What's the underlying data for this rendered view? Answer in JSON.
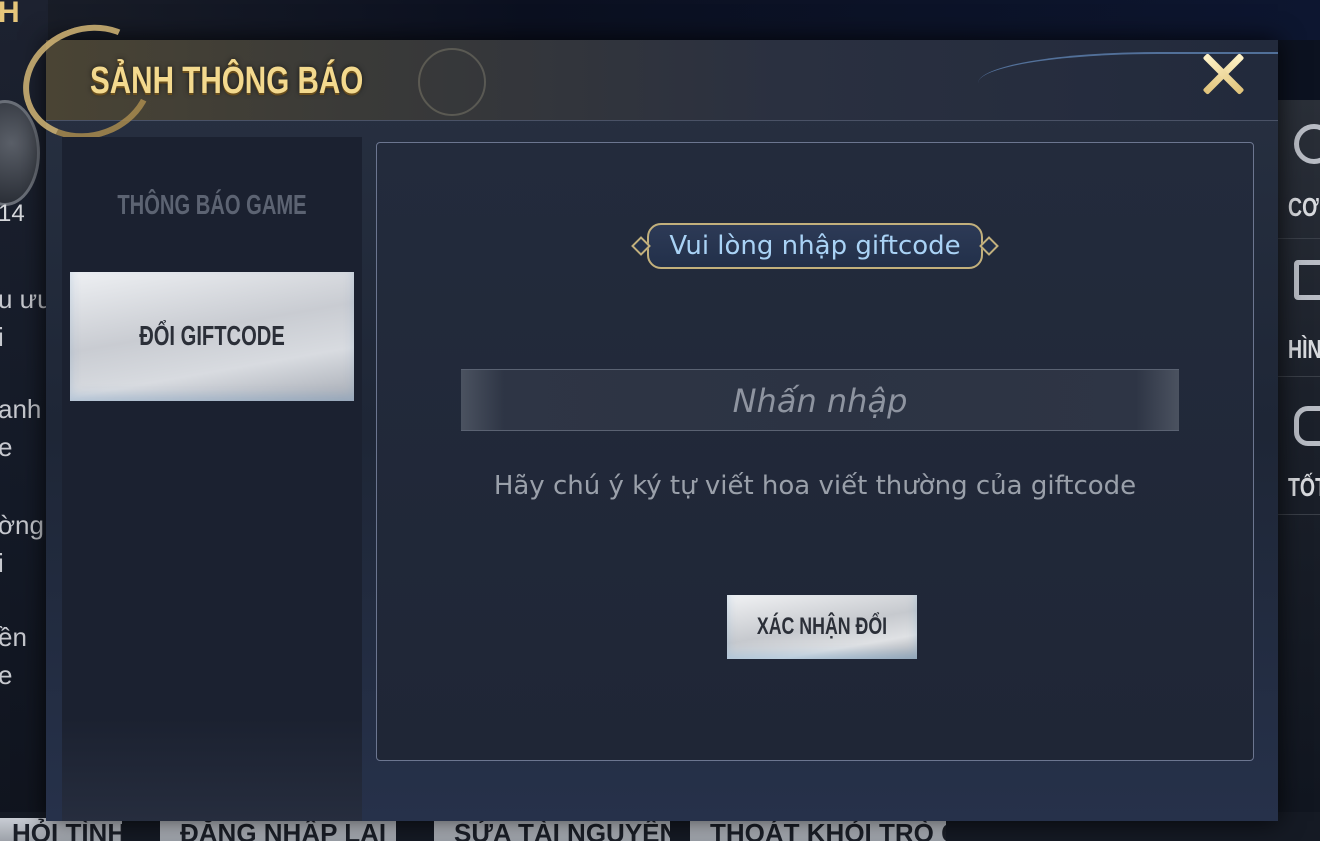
{
  "background": {
    "top_left_fragment": "H",
    "level_fragment": "14",
    "left_fragments": [
      "u ưu",
      "i",
      "anh",
      "e",
      "ờng",
      "i",
      "ền",
      "e"
    ],
    "right_menu": [
      {
        "label": "CƠ",
        "icon": "gear-icon"
      },
      {
        "label": "HÌNH",
        "icon": "monitor-icon"
      },
      {
        "label": "TỐT",
        "icon": "gamepad-icon"
      }
    ],
    "bottom_tabs": [
      "HỎI TÌNH",
      "ĐĂNG NHẬP LẠI",
      "SỬA TÀI NGUYÊN",
      "THOÁT KHỎI TRÒ CHƠI"
    ]
  },
  "modal": {
    "title": "SẢNH THÔNG BÁO",
    "close_icon": "close-icon",
    "accent_color": "#f3d98e"
  },
  "sidebar": {
    "items": [
      {
        "label": "THÔNG BÁO GAME",
        "active": false
      },
      {
        "label": "ĐỔI GIFTCODE",
        "active": true
      }
    ]
  },
  "giftcode": {
    "banner": "Vui lòng nhập giftcode",
    "input_placeholder": "Nhấn nhập",
    "hint": "Hãy chú ý ký tự viết hoa viết thường của giftcode",
    "confirm_label": "XÁC NHẬN ĐỔI"
  }
}
